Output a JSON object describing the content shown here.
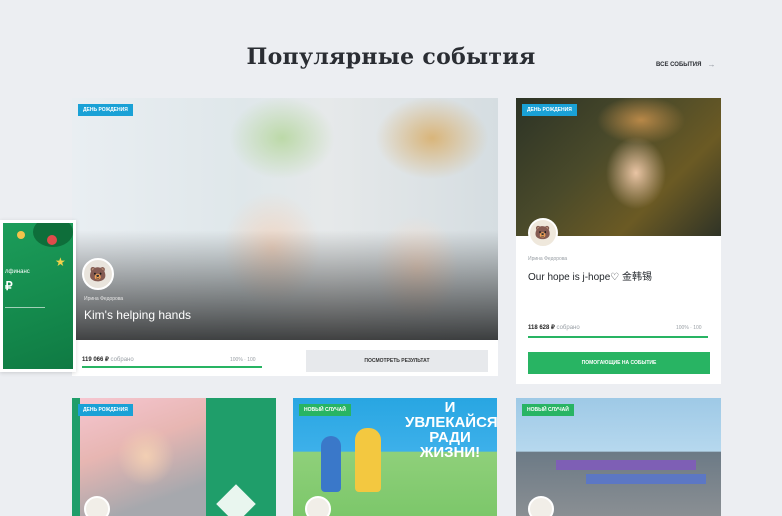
{
  "section": {
    "title": "Популярные события",
    "all_events_label": "ВСЕ СОБЫТИЯ",
    "all_events_arrow": "→"
  },
  "side_promo": {
    "line1": "лфинанс",
    "line2": "₽"
  },
  "cards": [
    {
      "badge": "ДЕНЬ РОЖДЕНИЯ",
      "author": "Ирина Федорова",
      "title": "Kim's helping hands",
      "amount": "119 066 ₽",
      "amount_suffix": "собрано",
      "percent_label": "100% · 100",
      "progress": 1.0,
      "button_label": "ПОСМОТРЕТЬ РЕЗУЛЬТАТ"
    },
    {
      "badge": "ДЕНЬ РОЖДЕНИЯ",
      "author": "Ирина Федорова",
      "title": "Our hope is j-hope♡ 金韩锡",
      "amount": "118 628 ₽",
      "amount_suffix": "собрано",
      "percent_label": "100% · 100",
      "progress": 1.0,
      "button_label": "ПОМОГАЮЩИЕ НА СОБЫТИЕ"
    },
    {
      "badge": "ДЕНЬ РОЖДЕНИЯ"
    },
    {
      "badge": "НОВЫЙ СЛУЧАЙ",
      "poster_text": "И УВЛЕКАЙСЯ РАДИ ЖИЗНИ!"
    },
    {
      "badge": "НОВЫЙ СЛУЧАЙ"
    }
  ],
  "colors": {
    "accent_green": "#28b463",
    "badge_blue": "#1aa1d6",
    "background": "#eceef2"
  }
}
